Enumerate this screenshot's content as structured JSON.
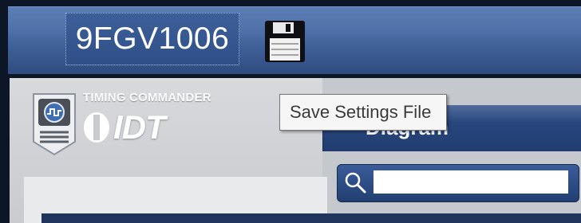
{
  "header": {
    "device_name": "9FGV1006",
    "save_icon": "floppy-disk-icon"
  },
  "brand": {
    "product_name": "TIMING COMMANDER",
    "company_logo_text": "IDT",
    "badge_icon": "clock-waveform-badge-icon"
  },
  "diagram_panel": {
    "title": "Diagram"
  },
  "search": {
    "icon": "search-icon",
    "value": "",
    "placeholder": ""
  },
  "tooltip": {
    "text": "Save Settings File"
  },
  "colors": {
    "header_gradient_top": "#5d7eb5",
    "header_gradient_bottom": "#2f4c80",
    "dark_frame": "#0c1627",
    "panel_blue": "#213d70",
    "body_grey": "#c5c8cd"
  }
}
